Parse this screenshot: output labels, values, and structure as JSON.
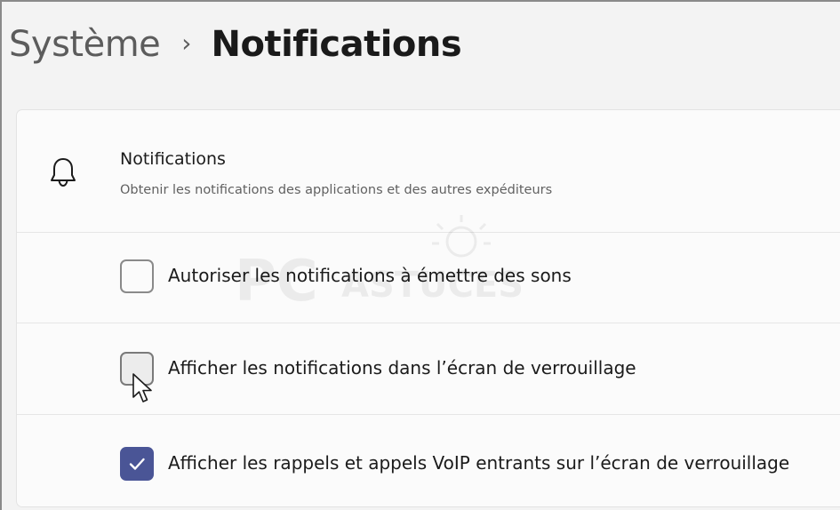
{
  "breadcrumb": {
    "parent": "Système",
    "separator": "›",
    "current": "Notifications"
  },
  "notifications": {
    "icon": "bell-icon",
    "title": "Notifications",
    "description": "Obtenir les notifications des applications et des autres expéditeurs"
  },
  "options": [
    {
      "label": "Autoriser les notifications à émettre des sons",
      "checked": false
    },
    {
      "label": "Afficher les notifications dans l’écran de verrouillage",
      "checked": false,
      "hovered": true
    },
    {
      "label": "Afficher les rappels et appels VoIP entrants sur l’écran de verrouillage",
      "checked": true
    }
  ],
  "watermark": {
    "text": "PC ASTUCES"
  },
  "colors": {
    "accent": "#4a5596",
    "background": "#f3f3f3",
    "card": "#fbfbfb"
  }
}
